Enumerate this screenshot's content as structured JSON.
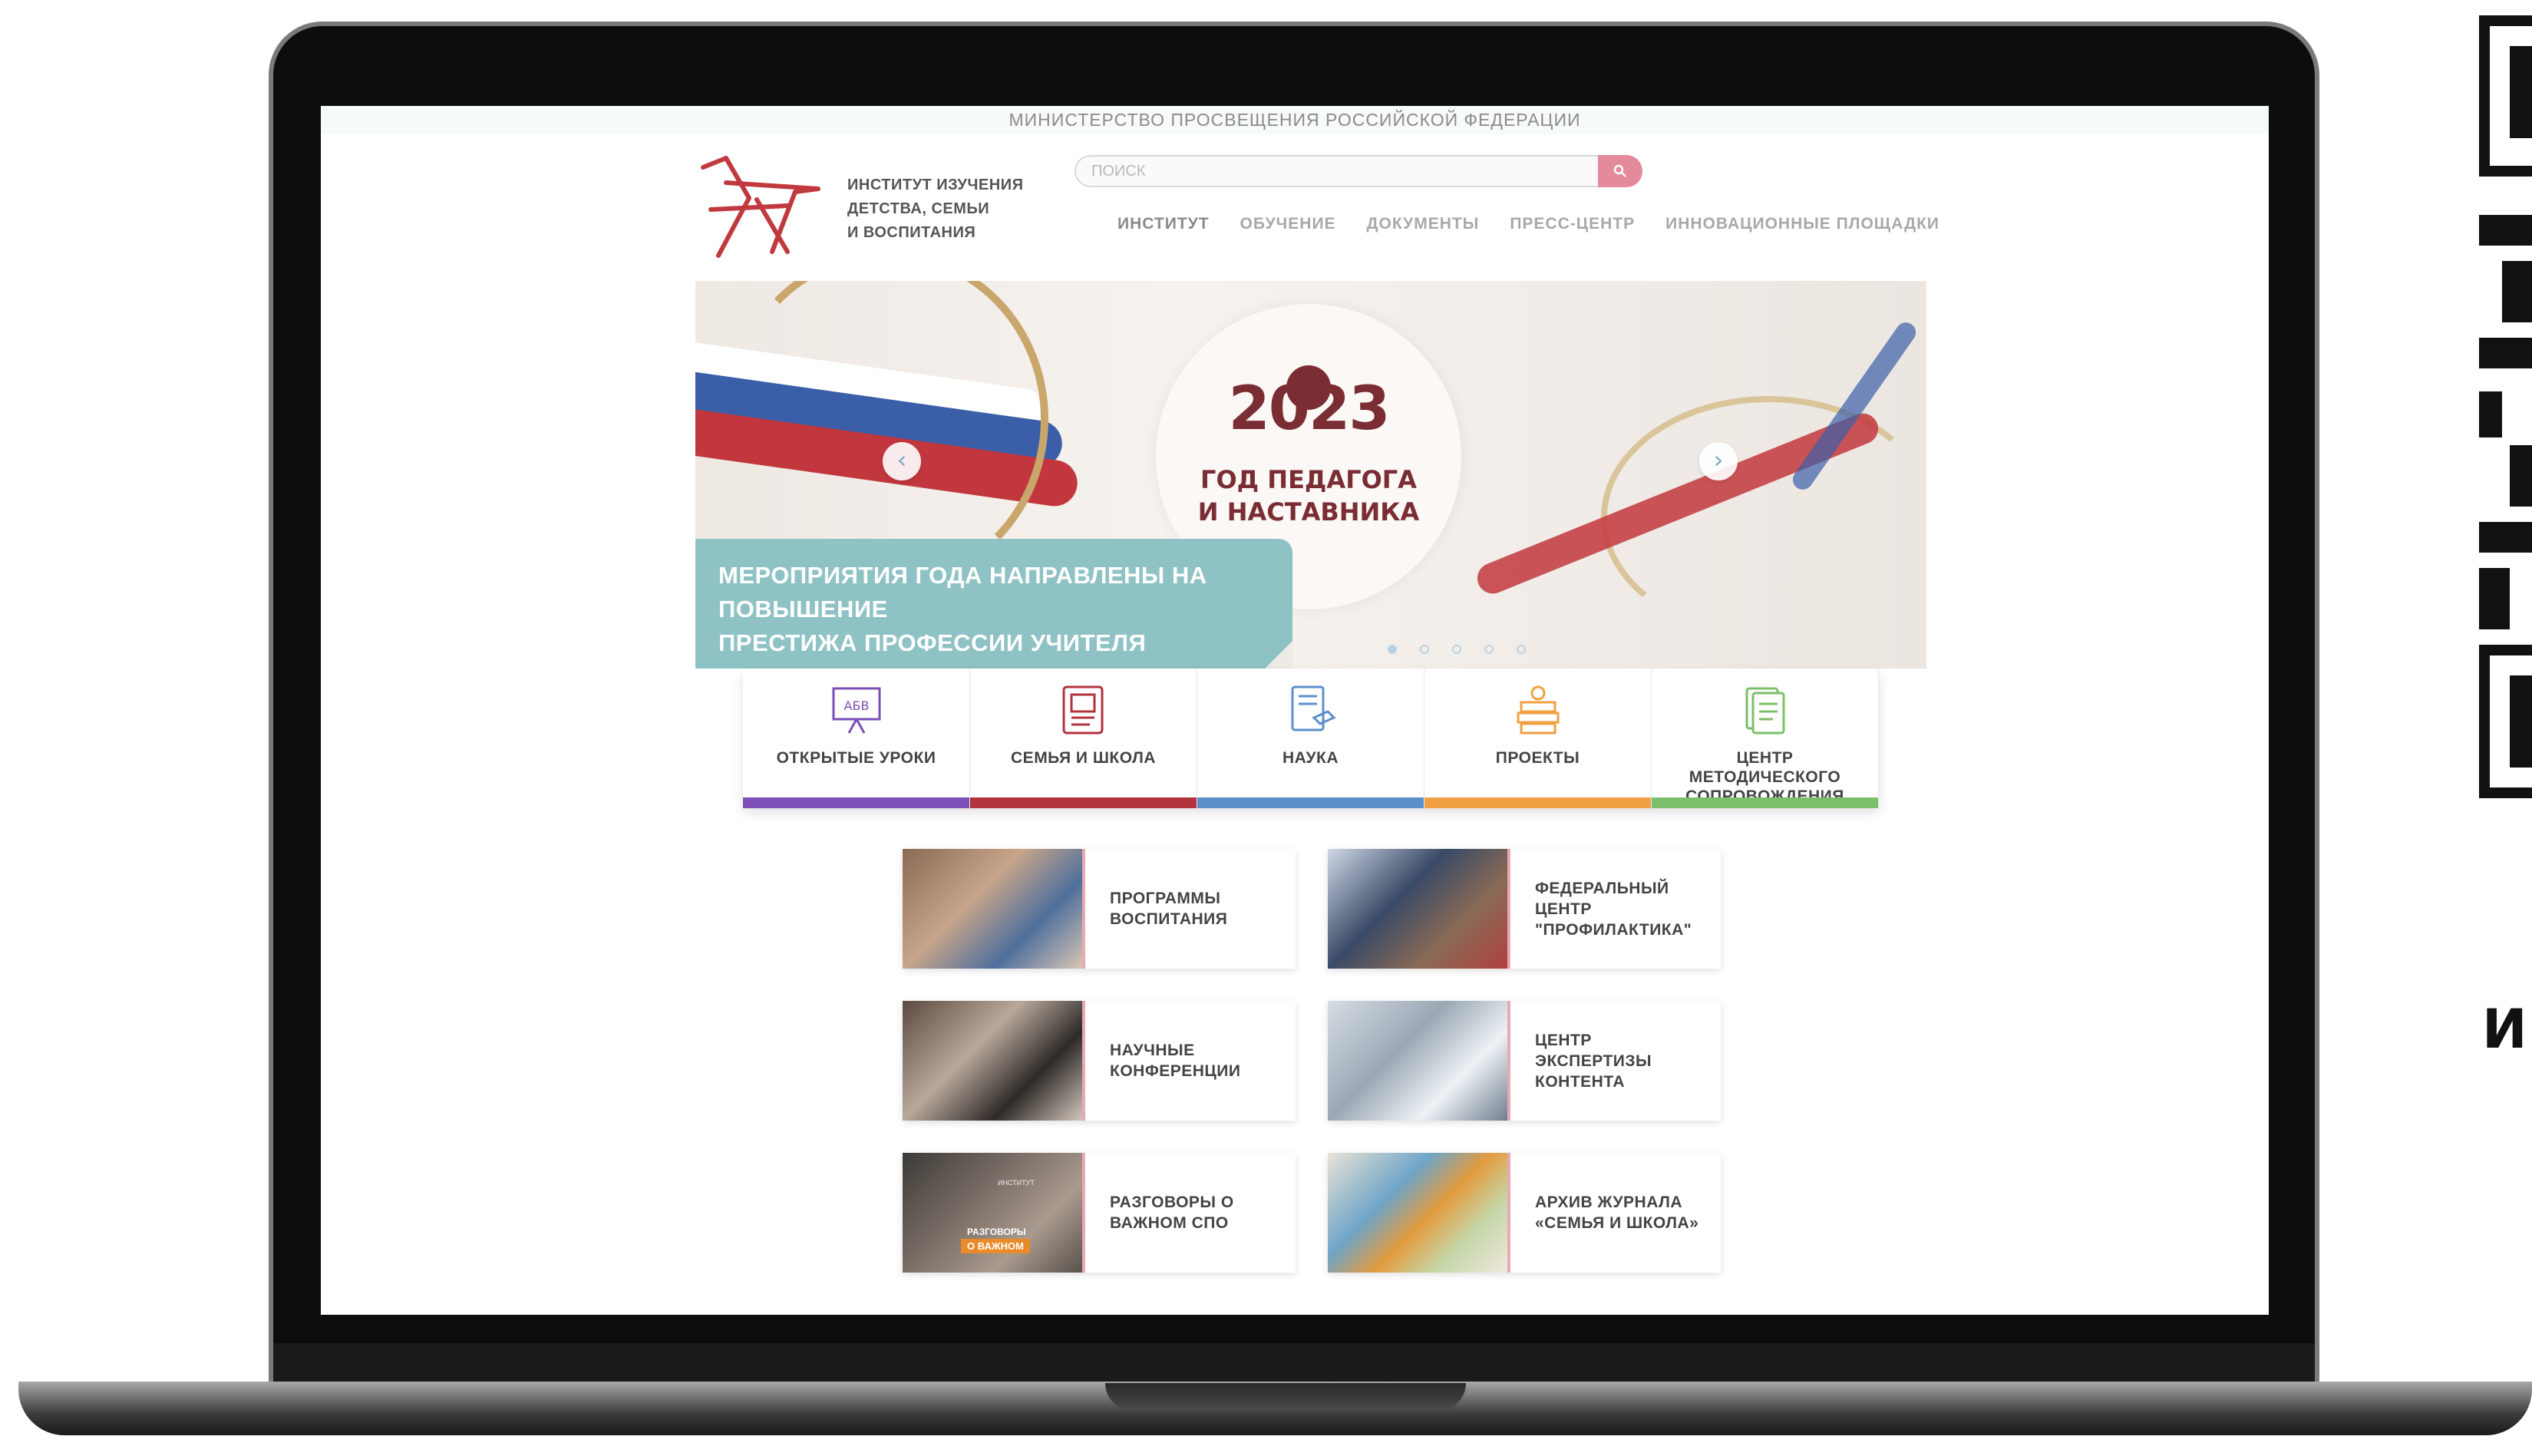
{
  "site": {
    "ministry": "МИНИСТЕРСТВО ПРОСВЕЩЕНИЯ РОССИЙСКОЙ ФЕДЕРАЦИИ",
    "logo_lines": [
      "ИНСТИТУТ ИЗУЧЕНИЯ",
      "ДЕТСТВА, СЕМЬИ",
      "И ВОСПИТАНИЯ"
    ],
    "search_placeholder": "ПОИСК",
    "nav": [
      "ИНСТИТУТ",
      "ОБУЧЕНИЕ",
      "ДОКУМЕНТЫ",
      "ПРЕСС-ЦЕНТР",
      "ИННОВАЦИОННЫЕ ПЛОЩАДКИ"
    ]
  },
  "slider": {
    "year": "2023",
    "year_title_lines": [
      "ГОД ПЕДАГОГА",
      "И НАСТАВНИКА"
    ],
    "caption_lines": [
      "МЕРОПРИЯТИЯ ГОДА НАПРАВЛЕНЫ НА ПОВЫШЕНИЕ",
      "ПРЕСТИЖА ПРОФЕССИИ УЧИТЕЛЯ"
    ],
    "prev_icon": "chevron-left-icon",
    "next_icon": "chevron-right-icon",
    "dot_count": 5,
    "active_dot": 1
  },
  "categories": [
    {
      "label": "ОТКРЫТЫЕ УРОКИ",
      "icon": "blackboard-icon",
      "color": "#7b4fb5"
    },
    {
      "label": "СЕМЬЯ И ШКОЛА",
      "icon": "newspaper-icon",
      "color": "#b2323e"
    },
    {
      "label": "НАУКА",
      "icon": "book-icon",
      "color": "#5b8fcb"
    },
    {
      "label": "ПРОЕКТЫ",
      "icon": "books-apple-icon",
      "color": "#f0a042"
    },
    {
      "label": "ЦЕНТР МЕТОДИЧЕСКОГО СОПРОВОЖДЕНИЯ",
      "icon": "documents-icon",
      "color": "#7cbf6a"
    }
  ],
  "tiles": [
    {
      "label": "ПРОГРАММЫ ВОСПИТАНИЯ"
    },
    {
      "label": "ФЕДЕРАЛЬНЫЙ ЦЕНТР \"ПРОФИЛАКТИКА\""
    },
    {
      "label": "НАУЧНЫЕ КОНФЕРЕНЦИИ"
    },
    {
      "label": "ЦЕНТР ЭКСПЕРТИЗЫ КОНТЕНТА"
    },
    {
      "label": "РАЗГОВОРЫ О ВАЖНОМ СПО",
      "image_text": [
        "ИНСТИТУТ",
        "РАЗГОВОРЫ",
        "О ВАЖНОМ"
      ]
    },
    {
      "label": "АРХИВ ЖУРНАЛА «СЕМЬЯ И ШКОЛА»"
    }
  ],
  "side_text": "ИН",
  "colors": {
    "accent": "#e58a9b",
    "caption_bg": "#8fc2c4",
    "brand": "#7a2d33"
  }
}
